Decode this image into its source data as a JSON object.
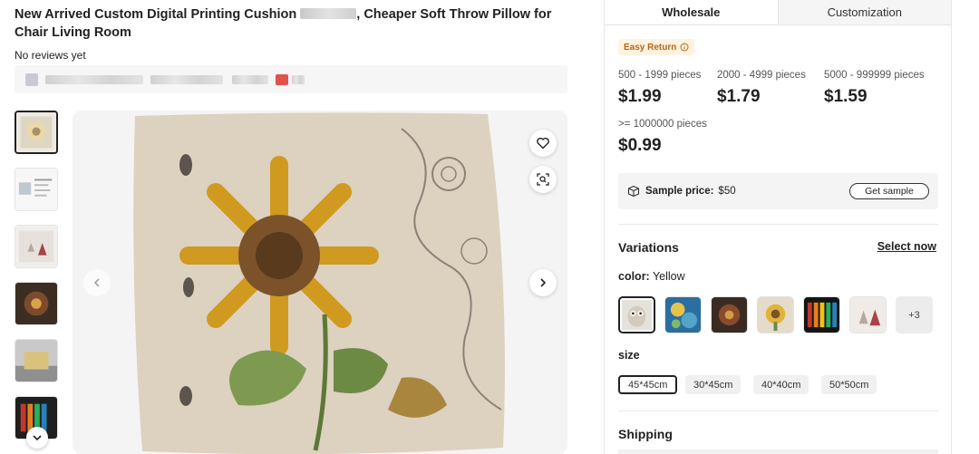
{
  "product": {
    "title_part1": "New Arrived Custom Digital Printing Cushion",
    "title_part2": ", Cheaper Soft Throw Pillow for Chair Living Room",
    "reviews": "No reviews yet"
  },
  "tabs": [
    {
      "label": "Wholesale",
      "active": true
    },
    {
      "label": "Customization",
      "active": false
    }
  ],
  "easy_return": "Easy Return",
  "price_tiers": [
    {
      "range": "500 - 1999 pieces",
      "price": "$1.99"
    },
    {
      "range": "2000 - 4999 pieces",
      "price": "$1.79"
    },
    {
      "range": "5000 - 999999 pieces",
      "price": "$1.59"
    },
    {
      "range": ">= 1000000 pieces",
      "price": "$0.99"
    }
  ],
  "sample": {
    "label": "Sample price:",
    "value": "$50",
    "button": "Get sample"
  },
  "variations": {
    "title": "Variations",
    "select_now": "Select now",
    "color_label": "color:",
    "color_value": "Yellow",
    "swatches": [
      {
        "name": "owl",
        "selected": true
      },
      {
        "name": "blue-floral",
        "selected": false
      },
      {
        "name": "dark-pattern",
        "selected": false
      },
      {
        "name": "sunflower",
        "selected": false
      },
      {
        "name": "flag",
        "selected": false
      },
      {
        "name": "trees",
        "selected": false
      }
    ],
    "more": "+3",
    "size_label": "size",
    "sizes": [
      {
        "label": "45*45cm",
        "selected": true
      },
      {
        "label": "30*45cm",
        "selected": false
      },
      {
        "label": "40*40cm",
        "selected": false
      },
      {
        "label": "50*50cm",
        "selected": false
      }
    ]
  },
  "shipping": {
    "title": "Shipping"
  },
  "icons": {
    "heart": "heart-icon",
    "image_search": "image-search-icon",
    "prev": "chevron-left-icon",
    "next": "chevron-right-icon",
    "thumb_down": "chevron-down-icon",
    "info": "info-icon",
    "box": "box-icon"
  },
  "colors": {
    "easy_return_bg": "#fff3e0",
    "easy_return_text": "#b5651d",
    "accent_dark": "#222222"
  }
}
